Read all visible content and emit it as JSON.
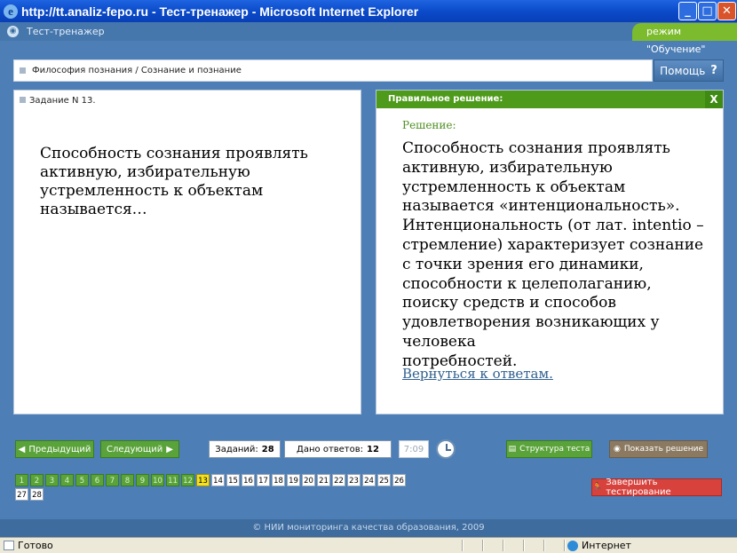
{
  "window": {
    "title": "http://tt.analiz-fepo.ru - Тест-тренажер - Microsoft Internet Explorer"
  },
  "header": {
    "app_title": "Тест-тренажер",
    "mode": "режим \"Обучение\""
  },
  "breadcrumb": {
    "text": "Философия познания / Сознание и познание"
  },
  "help_label": "Помощь",
  "task": {
    "number": "Задание N 13.",
    "question": "Способность сознания проявлять активную, избирательную устремленность к объектам называется…"
  },
  "solution": {
    "header": "Правильное решение:",
    "close": "X",
    "label": "Решение:",
    "text": "Способность сознания проявлять активную, избирательную устремленность к объектам называется «интенциональность». Интенциональность (от лат. intentio – стремление) характеризует сознание с точки зрения его динамики, способности к целеполаганию, поиску средств и способов удовлетворения возникающих у человека\n потребностей.",
    "return_link": "Вернуться к ответам."
  },
  "nav": {
    "prev": "Предыдущий",
    "next": "Следующий"
  },
  "counters": {
    "tasks_label": "Заданий:",
    "tasks_value": "28",
    "answers_label": "Дано ответов:",
    "answers_value": "12",
    "timer": "7:09"
  },
  "buttons": {
    "structure": "Структура теста",
    "show_solution": "Показать решение",
    "finish": "Завершить тестирование"
  },
  "task_numbers": {
    "current": 13,
    "answered_through": 12,
    "total": 28
  },
  "footer": "© НИИ мониторинга качества образования, 2009",
  "status": {
    "ready": "Готово",
    "zone": "Интернет"
  }
}
